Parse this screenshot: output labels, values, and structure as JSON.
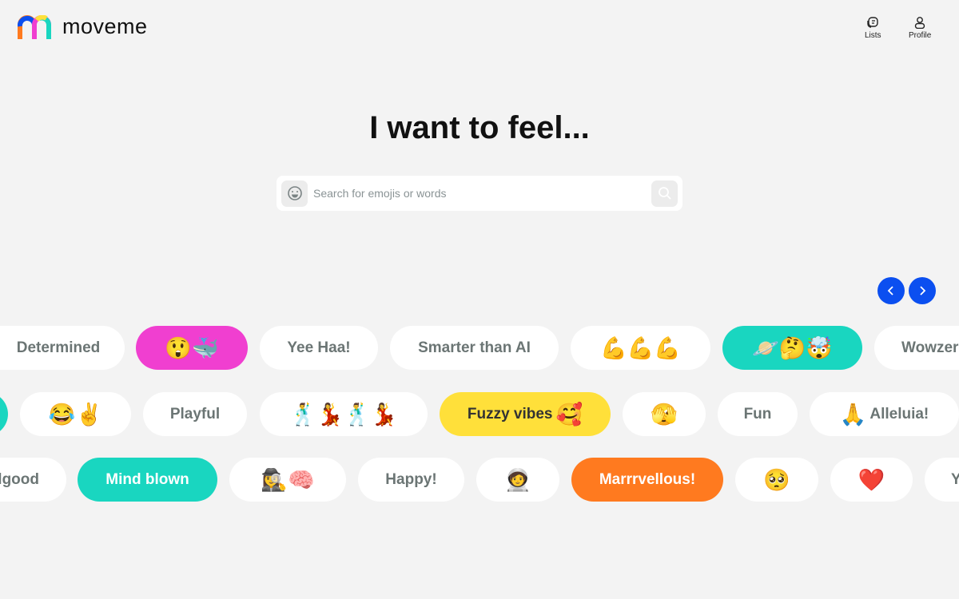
{
  "app": {
    "name": "moveme"
  },
  "nav": {
    "lists": "Lists",
    "profile": "Profile"
  },
  "heading": "I want to feel...",
  "search": {
    "placeholder": "Search for emojis or words"
  },
  "colors": {
    "pink": "#f03fd0",
    "teal": "#19d6c0",
    "yellow": "#ffe03a",
    "orange": "#ff7a1f",
    "blue": "#0b4ff0"
  },
  "rows": [
    [
      {
        "label": "Determined",
        "emoji": ""
      },
      {
        "label": "",
        "emoji": "😲🐳"
      },
      {
        "label": "Yee Haa!",
        "emoji": ""
      },
      {
        "label": "Smarter than AI",
        "emoji": ""
      },
      {
        "label": "",
        "emoji": "💪💪💪"
      },
      {
        "label": "",
        "emoji": "🪐🤔🤯"
      },
      {
        "label": "Wowzer",
        "emoji": ""
      }
    ],
    [
      {
        "label": "",
        "emoji": ""
      },
      {
        "label": "",
        "emoji": "😂✌️"
      },
      {
        "label": "Playful",
        "emoji": ""
      },
      {
        "label": "",
        "emoji": "🕺💃🕺💃"
      },
      {
        "label": "Fuzzy vibes",
        "emoji": "🥰"
      },
      {
        "label": "",
        "emoji": "🫣"
      },
      {
        "label": "Fun",
        "emoji": ""
      },
      {
        "label": "Alleluia!",
        "emoji": "🙏"
      }
    ],
    [
      {
        "label": "lgood",
        "emoji": ""
      },
      {
        "label": "Mind blown",
        "emoji": ""
      },
      {
        "label": "",
        "emoji": "🕵️‍♀️🧠"
      },
      {
        "label": "Happy!",
        "emoji": ""
      },
      {
        "label": "",
        "emoji": "🧑‍🚀"
      },
      {
        "label": "Marrrvellous!",
        "emoji": ""
      },
      {
        "label": "",
        "emoji": "🥺"
      },
      {
        "label": "",
        "emoji": "❤️"
      },
      {
        "label": "Y",
        "emoji": ""
      }
    ]
  ]
}
